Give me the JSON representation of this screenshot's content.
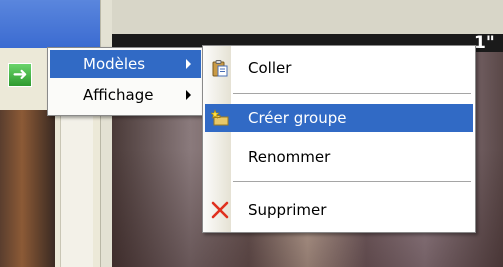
{
  "background": {
    "overlay_number": "1\""
  },
  "main_menu": {
    "items": [
      {
        "label": "Modèles",
        "has_submenu": true,
        "highlighted": true
      },
      {
        "label": "Affichage",
        "has_submenu": true,
        "highlighted": false
      }
    ]
  },
  "submenu": {
    "items": [
      {
        "label": "Coller",
        "icon": "clipboard-paste-icon"
      },
      {
        "label": "Créer groupe",
        "icon": "new-folder-icon",
        "highlighted": true
      },
      {
        "label": "Renommer"
      },
      {
        "label": "Supprimer",
        "icon": "delete-x-icon"
      }
    ]
  },
  "colors": {
    "highlight": "#316ac5",
    "menu_background": "#ffffff",
    "delete_red": "#e0301e"
  }
}
